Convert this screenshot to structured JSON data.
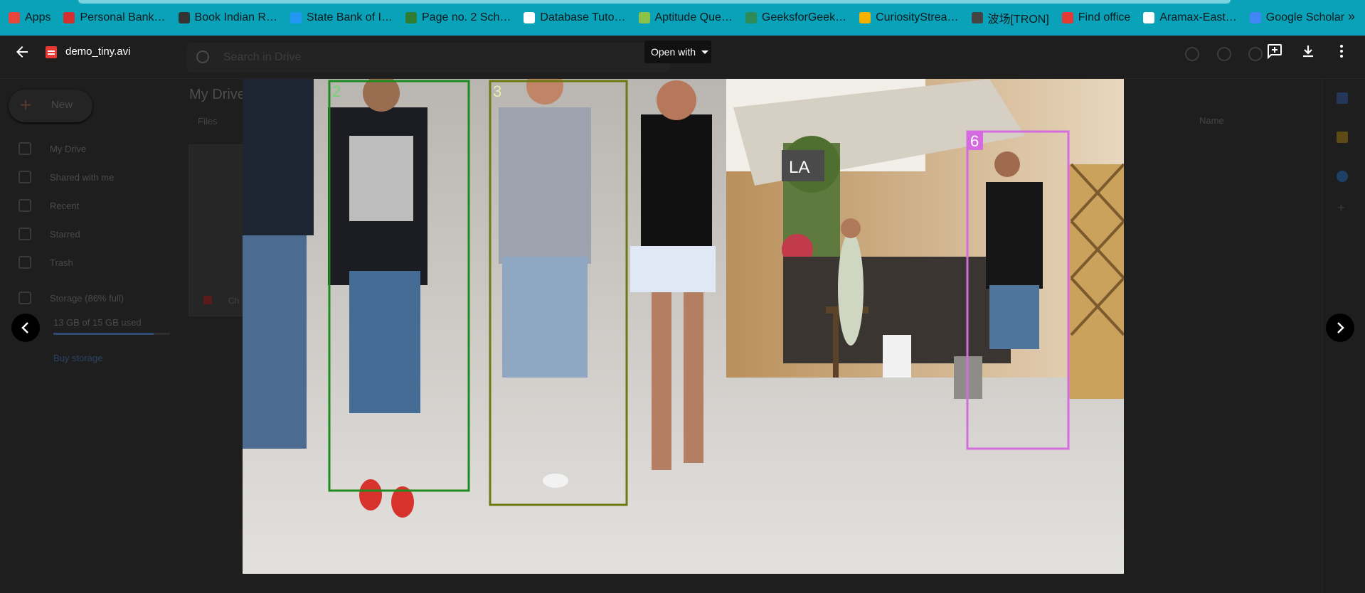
{
  "bookmarks": [
    {
      "label": "Apps",
      "icon": "apps-grid-icon",
      "color": "#e8453c"
    },
    {
      "label": "Personal Bank…",
      "icon": "bank-icon",
      "color": "#d32f2f"
    },
    {
      "label": "Book Indian R…",
      "icon": "irctc-icon",
      "color": "#333333"
    },
    {
      "label": "State Bank of I…",
      "icon": "sbi-icon",
      "color": "#2196f3"
    },
    {
      "label": "Page no. 2 Sch…",
      "icon": "page-icon",
      "color": "#2e7d32"
    },
    {
      "label": "Database Tuto…",
      "icon": "database-icon",
      "color": "#ffffff"
    },
    {
      "label": "Aptitude Que…",
      "icon": "aptitude-icon",
      "color": "#8bc34a"
    },
    {
      "label": "GeeksforGeek…",
      "icon": "gfg-icon",
      "color": "#2e8b57"
    },
    {
      "label": "CuriosityStrea…",
      "icon": "curiosity-icon",
      "color": "#f5b100"
    },
    {
      "label": "波场[TRON]",
      "icon": "tron-icon",
      "color": "#444444"
    },
    {
      "label": "Find office",
      "icon": "office-icon",
      "color": "#e53935"
    },
    {
      "label": "Aramax-East…",
      "icon": "aramex-icon",
      "color": "#ffffff"
    },
    {
      "label": "Google Scholar",
      "icon": "scholar-icon",
      "color": "#4285f4"
    }
  ],
  "viewer": {
    "file_name": "demo_tiny.avi",
    "open_with_label": "Open with"
  },
  "drive_background": {
    "search_placeholder": "Search in Drive",
    "new_label": "New",
    "title": "My Drive",
    "files_label": "Files",
    "name_column": "Name",
    "sidebar": [
      {
        "label": "My Drive",
        "icon": "drive-icon"
      },
      {
        "label": "Shared with me",
        "icon": "people-icon"
      },
      {
        "label": "Recent",
        "icon": "clock-icon"
      },
      {
        "label": "Starred",
        "icon": "star-icon"
      },
      {
        "label": "Trash",
        "icon": "trash-icon"
      }
    ],
    "storage_label": "Storage (86% full)",
    "storage_used": "13 GB of 15 GB used",
    "storage_fraction": 0.86,
    "buy_storage": "Buy storage",
    "file_name_partial": "Ch"
  },
  "video_overlays": [
    {
      "id": "2",
      "color": "#1f8a1f"
    },
    {
      "id": "3",
      "color": "#6b7a12"
    },
    {
      "id": "6",
      "color": "#d66ae0"
    }
  ]
}
